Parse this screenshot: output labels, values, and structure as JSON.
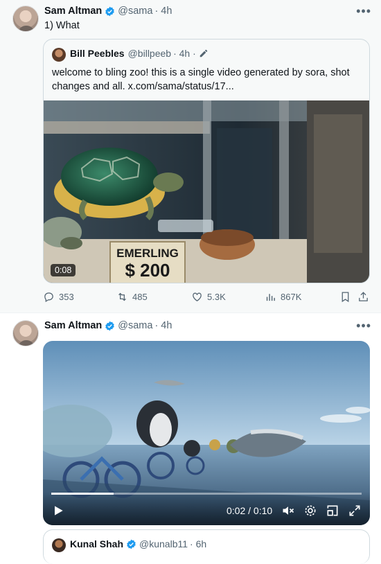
{
  "tweets": [
    {
      "author": "Sam Altman",
      "handle": "@sama",
      "time": "· 4h",
      "text": "1) What",
      "quote": {
        "author": "Bill Peebles",
        "handle": "@billpeeb",
        "time": "· 4h ·",
        "text": "welcome to bling zoo! this is a single video generated by sora, shot changes and all.  x.com/sama/status/17...",
        "media": {
          "duration": "0:08",
          "sign_line1": "EMERLING",
          "sign_line2": "$ 200"
        }
      },
      "actions": {
        "replies": "353",
        "reposts": "485",
        "likes": "5.3K",
        "views": "867K"
      }
    },
    {
      "author": "Sam Altman",
      "handle": "@sama",
      "time": "· 4h",
      "video": {
        "time": "0:02 / 0:10",
        "progress": 0.2
      },
      "quote": {
        "author": "Kunal Shah",
        "handle": "@kunalb11",
        "time": "· 6h"
      }
    }
  ],
  "colors": {
    "verified": "#1d9bf0",
    "muted_text": "#536471",
    "border": "#cfd9de"
  }
}
